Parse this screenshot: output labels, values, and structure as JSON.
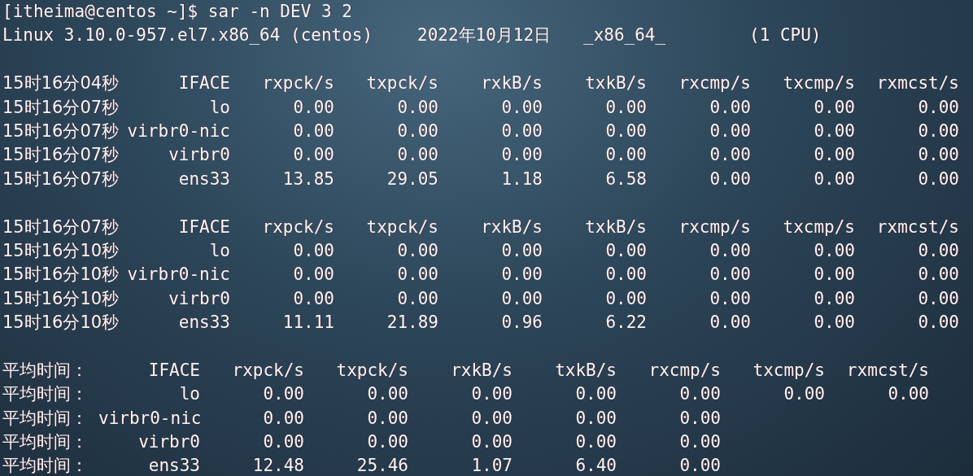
{
  "prompt": {
    "text": "[itheima@centos ~]$ sar -n DEV 3 2"
  },
  "system_info": [
    "Linux 3.10.0-957.el7.x86_64 (centos)",
    "2022年10月12日",
    "_x86_64_",
    "(1 CPU)"
  ],
  "sections": [
    {
      "kind": "interval",
      "header": [
        "15时16分04秒",
        "IFACE",
        "rxpck/s",
        "txpck/s",
        "rxkB/s",
        "txkB/s",
        "rxcmp/s",
        "txcmp/s",
        "rxmcst/s"
      ],
      "rows": [
        [
          "15时16分07秒",
          "lo",
          "0.00",
          "0.00",
          "0.00",
          "0.00",
          "0.00",
          "0.00",
          "0.00"
        ],
        [
          "15时16分07秒",
          "virbr0-nic",
          "0.00",
          "0.00",
          "0.00",
          "0.00",
          "0.00",
          "0.00",
          "0.00"
        ],
        [
          "15时16分07秒",
          "virbr0",
          "0.00",
          "0.00",
          "0.00",
          "0.00",
          "0.00",
          "0.00",
          "0.00"
        ],
        [
          "15时16分07秒",
          "ens33",
          "13.85",
          "29.05",
          "1.18",
          "6.58",
          "0.00",
          "0.00",
          "0.00"
        ]
      ]
    },
    {
      "kind": "interval",
      "header": [
        "15时16分07秒",
        "IFACE",
        "rxpck/s",
        "txpck/s",
        "rxkB/s",
        "txkB/s",
        "rxcmp/s",
        "txcmp/s",
        "rxmcst/s"
      ],
      "rows": [
        [
          "15时16分10秒",
          "lo",
          "0.00",
          "0.00",
          "0.00",
          "0.00",
          "0.00",
          "0.00",
          "0.00"
        ],
        [
          "15时16分10秒",
          "virbr0-nic",
          "0.00",
          "0.00",
          "0.00",
          "0.00",
          "0.00",
          "0.00",
          "0.00"
        ],
        [
          "15时16分10秒",
          "virbr0",
          "0.00",
          "0.00",
          "0.00",
          "0.00",
          "0.00",
          "0.00",
          "0.00"
        ],
        [
          "15时16分10秒",
          "ens33",
          "11.11",
          "21.89",
          "0.96",
          "6.22",
          "0.00",
          "0.00",
          "0.00"
        ]
      ]
    },
    {
      "kind": "average",
      "header": [
        "平均时间：",
        "IFACE",
        "rxpck/s",
        "txpck/s",
        "rxkB/s",
        "txkB/s",
        "rxcmp/s",
        "txcmp/s",
        "rxmcst/s"
      ],
      "rows": [
        [
          "平均时间：",
          "lo",
          "0.00",
          "0.00",
          "0.00",
          "0.00",
          "0.00",
          "0.00",
          "0.00"
        ],
        [
          "平均时间：",
          "virbr0-nic",
          "0.00",
          "0.00",
          "0.00",
          "0.00",
          "0.00"
        ],
        [
          "平均时间：",
          "virbr0",
          "0.00",
          "0.00",
          "0.00",
          "0.00",
          "0.00"
        ],
        [
          "平均时间：",
          "ens33",
          "12.48",
          "25.46",
          "1.07",
          "6.40",
          "0.00"
        ]
      ]
    }
  ]
}
